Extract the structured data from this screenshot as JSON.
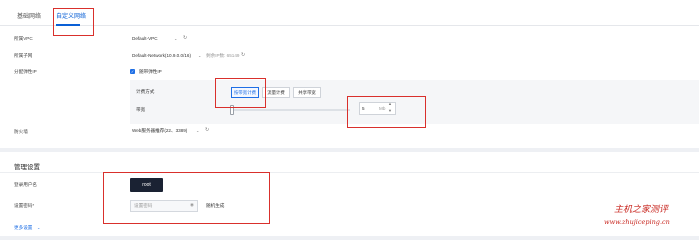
{
  "tabs": [
    {
      "label": "基础网络",
      "active": false
    },
    {
      "label": "自定义网络",
      "active": true
    }
  ],
  "network": {
    "vpc_label": "所属VPC",
    "vpc_value": "Default-VPC",
    "subnet_label": "所属子网",
    "subnet_value": "Default-Network(10.9.0.0/16)",
    "subnet_ip_info": "剩余IP数: 65149",
    "public_ip_label": "分配弹性IP",
    "public_ip_checkbox_label": "随带弹性IP",
    "billing_label": "计费方式",
    "billing_options": [
      "按带宽计费",
      "流量计费",
      "共享带宽"
    ],
    "bandwidth_label": "带宽",
    "bandwidth_value": "5",
    "bandwidth_unit": "Mb",
    "firewall_label": "防火墙",
    "firewall_value": "Web服务器推荐(22、3389)"
  },
  "management": {
    "section_title": "管理设置",
    "login_user_label": "登录用户名",
    "login_user_value": "root",
    "password_label": "设置密码*",
    "password_placeholder": "设置密码",
    "generate_link": "随机生成",
    "more_settings": "更多设置"
  },
  "watermark": {
    "cn": "主机之家测评",
    "url": "www.zhujiceping.cn"
  },
  "colors": {
    "accent": "#1f6fe5",
    "annotation_red": "#d9302c",
    "dark_button": "#1a2233"
  }
}
